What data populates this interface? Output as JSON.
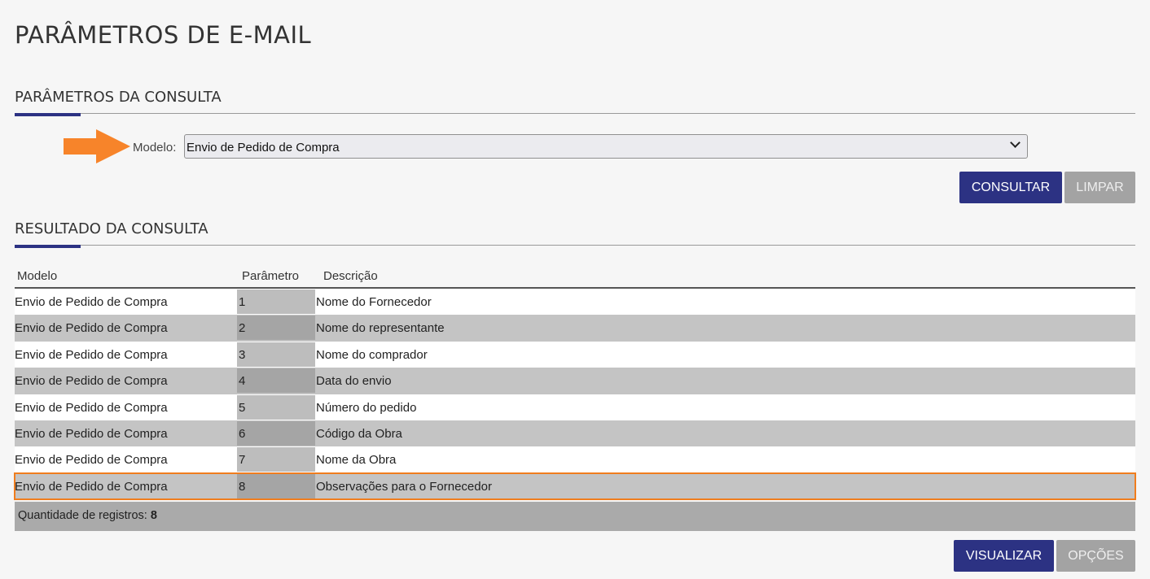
{
  "page": {
    "title": "PARÂMETROS DE E-MAIL"
  },
  "query_section": {
    "title": "PARÂMETROS DA CONSULTA",
    "model_label": "Modelo:",
    "model_value": "Envio de Pedido de Compra",
    "consult_button": "CONSULTAR",
    "clear_button": "LIMPAR"
  },
  "result_section": {
    "title": "RESULTADO DA CONSULTA",
    "columns": [
      "Modelo",
      "Parâmetro",
      "Descrição"
    ],
    "rows": [
      {
        "model": "Envio de Pedido de Compra",
        "param": "1",
        "desc": "Nome do Fornecedor"
      },
      {
        "model": "Envio de Pedido de Compra",
        "param": "2",
        "desc": "Nome do representante"
      },
      {
        "model": "Envio de Pedido de Compra",
        "param": "3",
        "desc": "Nome do comprador"
      },
      {
        "model": "Envio de Pedido de Compra",
        "param": "4",
        "desc": "Data do envio"
      },
      {
        "model": "Envio de Pedido de Compra",
        "param": "5",
        "desc": "Número do pedido"
      },
      {
        "model": "Envio de Pedido de Compra",
        "param": "6",
        "desc": "Código da Obra"
      },
      {
        "model": "Envio de Pedido de Compra",
        "param": "7",
        "desc": "Nome da Obra"
      },
      {
        "model": "Envio de Pedido de Compra",
        "param": "8",
        "desc": "Observações para o Fornecedor"
      }
    ],
    "count_label": "Quantidade de registros:",
    "count_value": "8",
    "view_button": "VISUALIZAR",
    "options_button": "OPÇÕES"
  },
  "colors": {
    "primary": "#2c3283",
    "disabled": "#a3a3a3",
    "highlight": "#f07d1e"
  },
  "icons": [
    "arrow-right-icon",
    "chevron-down-icon"
  ]
}
